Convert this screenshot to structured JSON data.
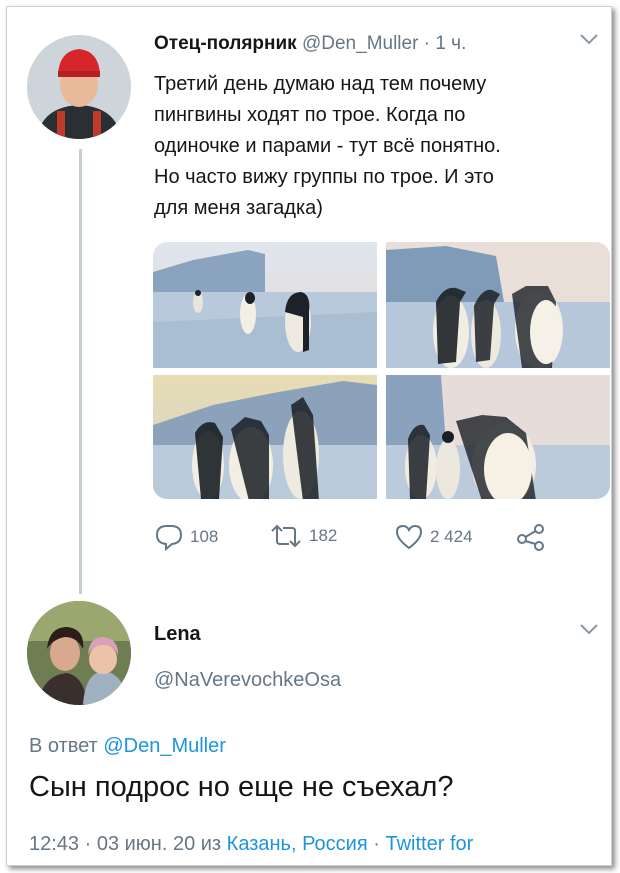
{
  "tweet": {
    "author_name": "Отец-полярник",
    "handle": "@Den_Muller",
    "time": "· 1 ч.",
    "text": "Третий день думаю над тем почему\nпингвины ходят по трое. Когда по\nодиночке и парами - тут всё понятно.\nНо часто вижу группы по трое. И это\nдля меня загадка)",
    "stats": {
      "replies": "108",
      "retweets": "182",
      "likes": "2 424"
    }
  },
  "reply": {
    "author_name": "Lena",
    "handle": "@NaVerevochkeOsa",
    "reply_prefix": "В ответ",
    "reply_to": "@Den_Muller",
    "text": "Сын подрос но еще не съехал?",
    "meta_time": "12:43 · 03 июн. 20 из",
    "meta_location": "Казань, Россия",
    "meta_sep": "·",
    "meta_client": "Twitter for"
  },
  "icons": {
    "reply": "comment-icon",
    "retweet": "retweet-icon",
    "like": "heart-icon",
    "share": "share-icon",
    "menu": "chevron-down-icon"
  },
  "colors": {
    "link": "#1b95e0",
    "muted": "#657786",
    "thread_line": "#c4cfd6"
  }
}
